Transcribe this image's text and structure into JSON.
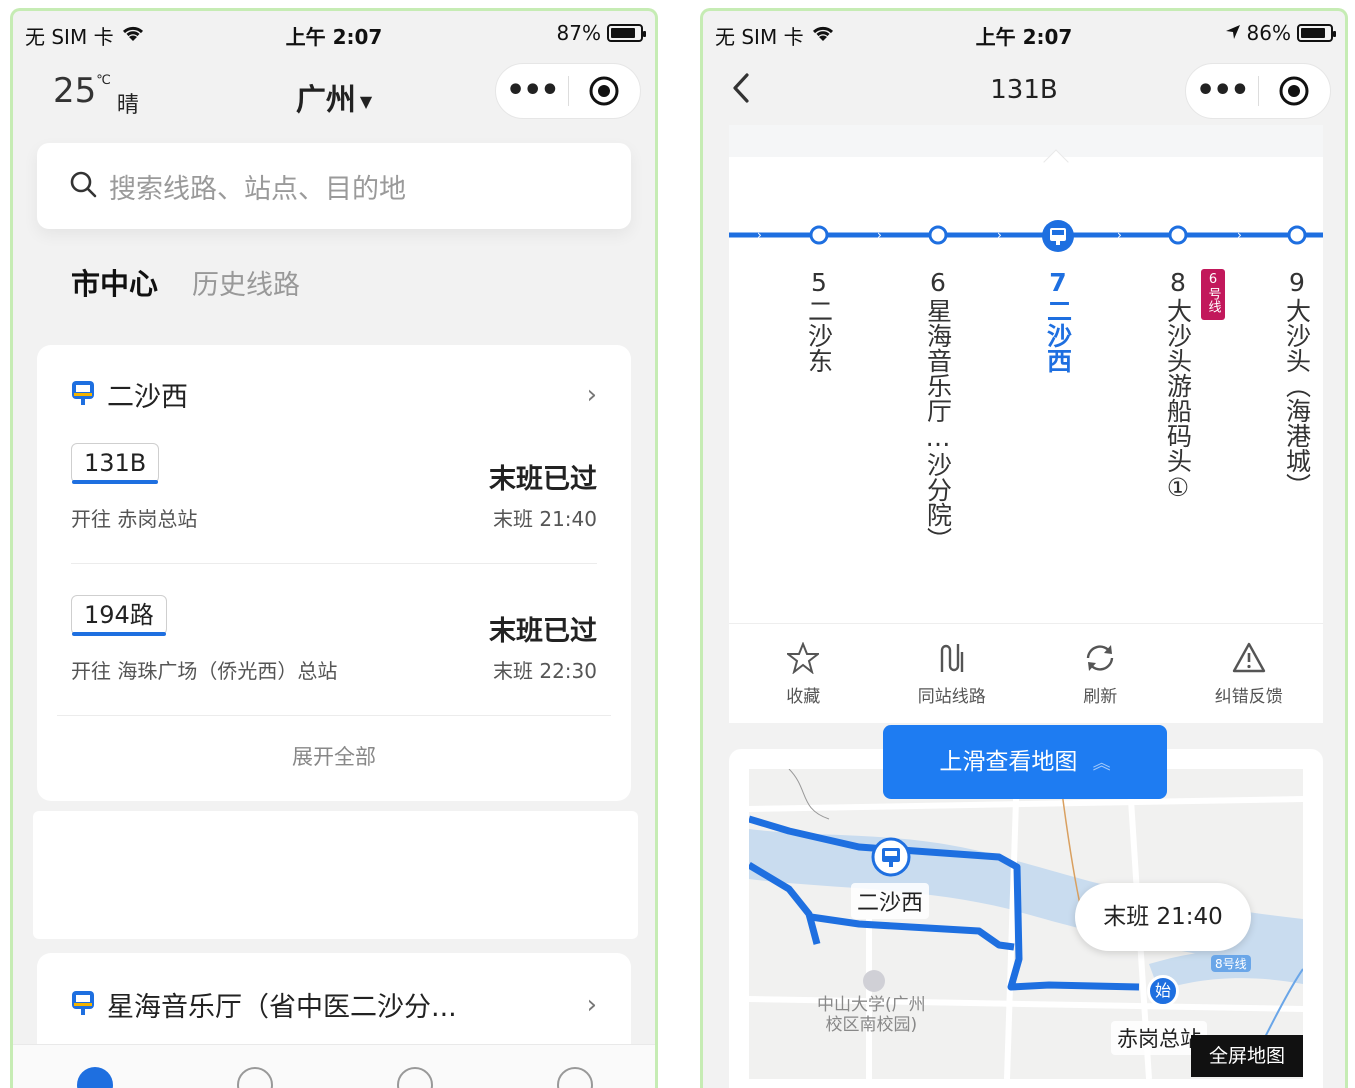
{
  "left": {
    "status": {
      "carrier": "无 SIM 卡",
      "time": "上午 2:07",
      "battery": "87%",
      "battery_level": 0.87
    },
    "weather": {
      "temp": "25",
      "unit": "℃",
      "condition": "晴"
    },
    "city": "广州",
    "search": {
      "placeholder": "搜索线路、站点、目的地"
    },
    "tabs": {
      "active": "市中心",
      "inactive": "历史线路"
    },
    "station1": {
      "name": "二沙西",
      "routes": [
        {
          "number": "131B",
          "direction": "开往 赤岗总站",
          "status": "末班已过",
          "last": "末班 21:40"
        },
        {
          "number": "194路",
          "direction": "开往 海珠广场（侨光西）总站",
          "status": "末班已过",
          "last": "末班 22:30"
        }
      ],
      "expand": "展开全部"
    },
    "station2": {
      "name": "星海音乐厅（省中医二沙分..."
    },
    "accent": "#1e6fe0"
  },
  "right": {
    "status": {
      "carrier": "无 SIM 卡",
      "time": "上午 2:07",
      "battery": "86%",
      "battery_level": 0.86
    },
    "route": "131B",
    "stops": [
      {
        "num": "5",
        "name": "二沙东"
      },
      {
        "num": "6",
        "name": "星海音乐厅…沙分院）"
      },
      {
        "num": "7",
        "name": "二沙西",
        "active": true
      },
      {
        "num": "8",
        "name": "大沙头游船码头①",
        "metro": "6号线"
      },
      {
        "num": "9",
        "name": "大沙头（海港城）"
      }
    ],
    "actions": [
      "收藏",
      "同站线路",
      "刷新",
      "纠错反馈"
    ],
    "slide_up": "上滑查看地图",
    "map": {
      "station": "二沙西",
      "last_bus": "末班 21:40",
      "start": "始",
      "terminal": "赤岗总站",
      "campus": "中山大学(广州\n校区南校园)",
      "metro": "8号线",
      "fullscreen": "全屏地图"
    },
    "accent": "#1e7cf2"
  }
}
